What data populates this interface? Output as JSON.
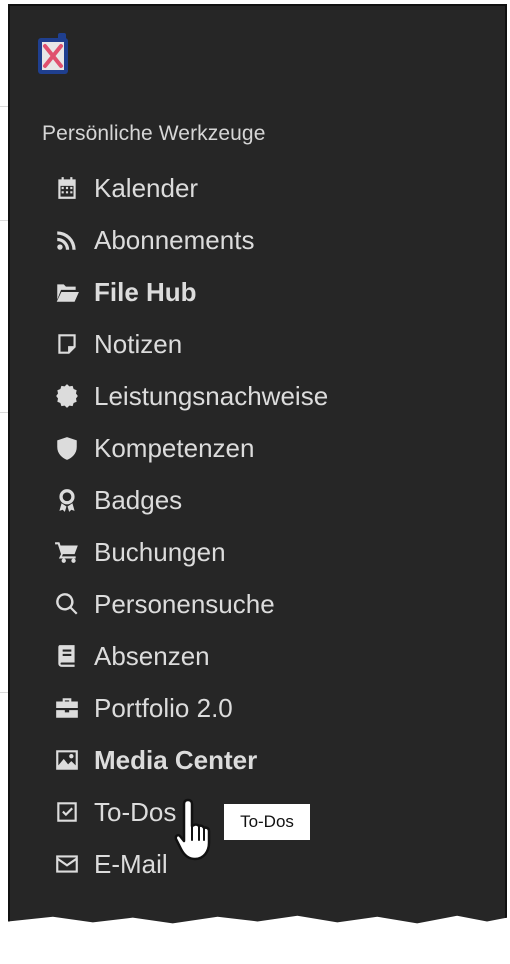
{
  "app": {
    "logo_icon": "close-x-logo-icon"
  },
  "sidebar": {
    "section_title": "Persönliche Werkzeuge",
    "items": [
      {
        "label": "Kalender",
        "icon": "calendar-icon"
      },
      {
        "label": "Abonnements",
        "icon": "rss-icon"
      },
      {
        "label": "File Hub",
        "icon": "folder-open-icon"
      },
      {
        "label": "Notizen",
        "icon": "note-icon"
      },
      {
        "label": "Leistungsnachweise",
        "icon": "seal-icon"
      },
      {
        "label": "Kompetenzen",
        "icon": "shield-icon"
      },
      {
        "label": "Badges",
        "icon": "award-icon"
      },
      {
        "label": "Buchungen",
        "icon": "cart-icon"
      },
      {
        "label": "Personensuche",
        "icon": "search-icon"
      },
      {
        "label": "Absenzen",
        "icon": "book-icon"
      },
      {
        "label": "Portfolio 2.0",
        "icon": "briefcase-icon"
      },
      {
        "label": "Media Center",
        "icon": "image-icon"
      },
      {
        "label": "To-Dos",
        "icon": "checkbox-icon"
      },
      {
        "label": "E-Mail",
        "icon": "envelope-icon"
      }
    ]
  },
  "tooltip": {
    "text": "To-Dos"
  },
  "colors": {
    "panel_bg": "#262626",
    "text": "#dcdcdc",
    "logo_blue": "#1f3f8f",
    "logo_pink": "#e0506e"
  }
}
